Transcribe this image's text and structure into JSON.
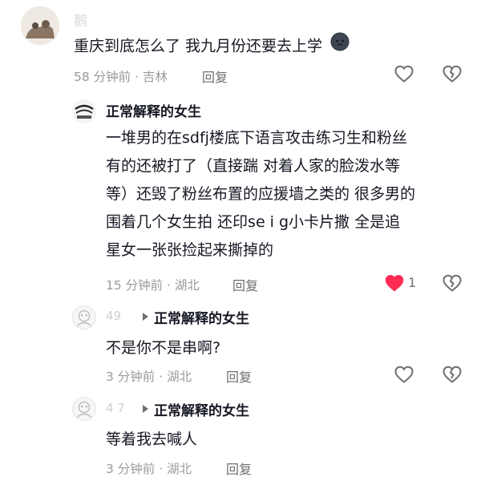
{
  "comment_top": {
    "username": "鹅",
    "text": "重庆到底怎么了 我九月份还要去上学",
    "emoji": "crying-ghost-emoji",
    "meta": "58 分钟前 · 吉林",
    "reply_label": "回复"
  },
  "reply_1": {
    "author": "正常解释的女生",
    "text_lines": [
      "一堆男的在sdfj楼底下语言攻击练习生和粉丝",
      "有的还被打了（直接踹 对着人家的脸泼水等",
      "等）还毁了粉丝布置的应援墙之类的 很多男的",
      "围着几个女生拍 还印se i g小卡片撒 全是追",
      "星女一张张捡起来撕掉的"
    ],
    "meta": "15 分钟前 · 湖北",
    "reply_label": "回复",
    "like_count": "1"
  },
  "reply_2": {
    "replier": "49",
    "replied_to": "正常解释的女生",
    "text": "不是你不是串啊?",
    "meta": "3 分钟前 · 湖北",
    "reply_label": "回复"
  },
  "reply_3": {
    "replier": "4 7",
    "replied_to": "正常解释的女生",
    "text": "等着我去喊人",
    "meta": "3 分钟前 · 湖北",
    "reply_label": "回复"
  },
  "colors": {
    "like_active": "#fe2c55",
    "icon_gray": "#6e6e73",
    "meta_gray": "#9a9a9e"
  }
}
